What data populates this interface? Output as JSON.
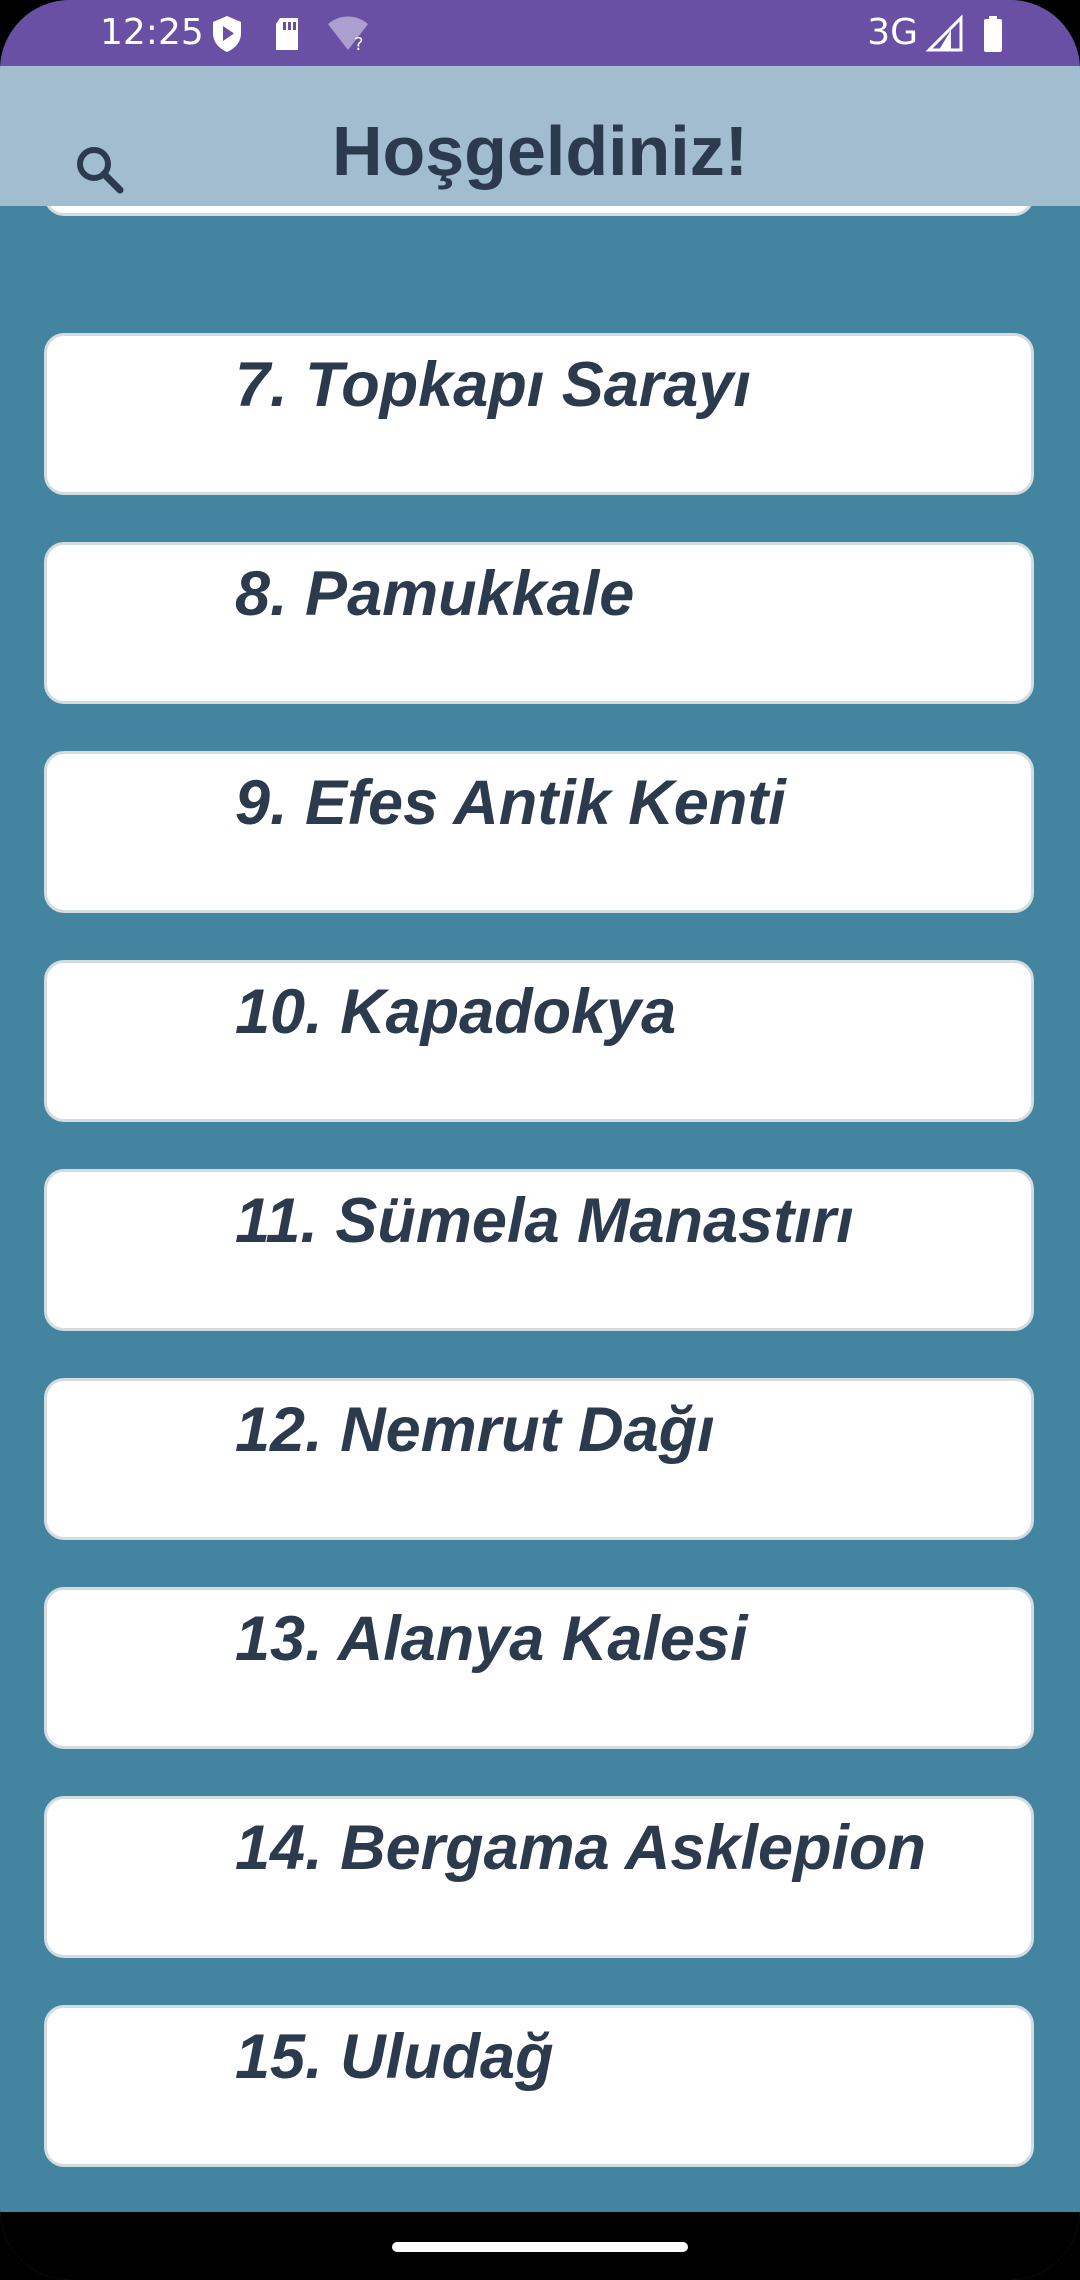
{
  "status_bar": {
    "time": "12:25",
    "network": "3G",
    "icons": [
      "shield-play-icon",
      "sd-card-icon",
      "wifi-unknown-icon",
      "cell-signal-icon",
      "battery-icon"
    ]
  },
  "app_bar": {
    "title": "Hoşgeldiniz!",
    "search_icon": "search-icon"
  },
  "places": [
    {
      "label": ""
    },
    {
      "label": "7. Topkapı Sarayı"
    },
    {
      "label": "8. Pamukkale"
    },
    {
      "label": "9. Efes Antik Kenti"
    },
    {
      "label": "10. Kapadokya"
    },
    {
      "label": "11. Sümela Manastırı"
    },
    {
      "label": "12. Nemrut Dağı"
    },
    {
      "label": "13. Alanya Kalesi"
    },
    {
      "label": "14. Bergama Asklepion"
    },
    {
      "label": "15. Uludağ"
    }
  ],
  "colors": {
    "status_bar": "#6A50A4",
    "app_bar": "#A2BDD0",
    "background": "#4385A0",
    "card": "#FFFFFF",
    "text": "#2C3A4E"
  }
}
